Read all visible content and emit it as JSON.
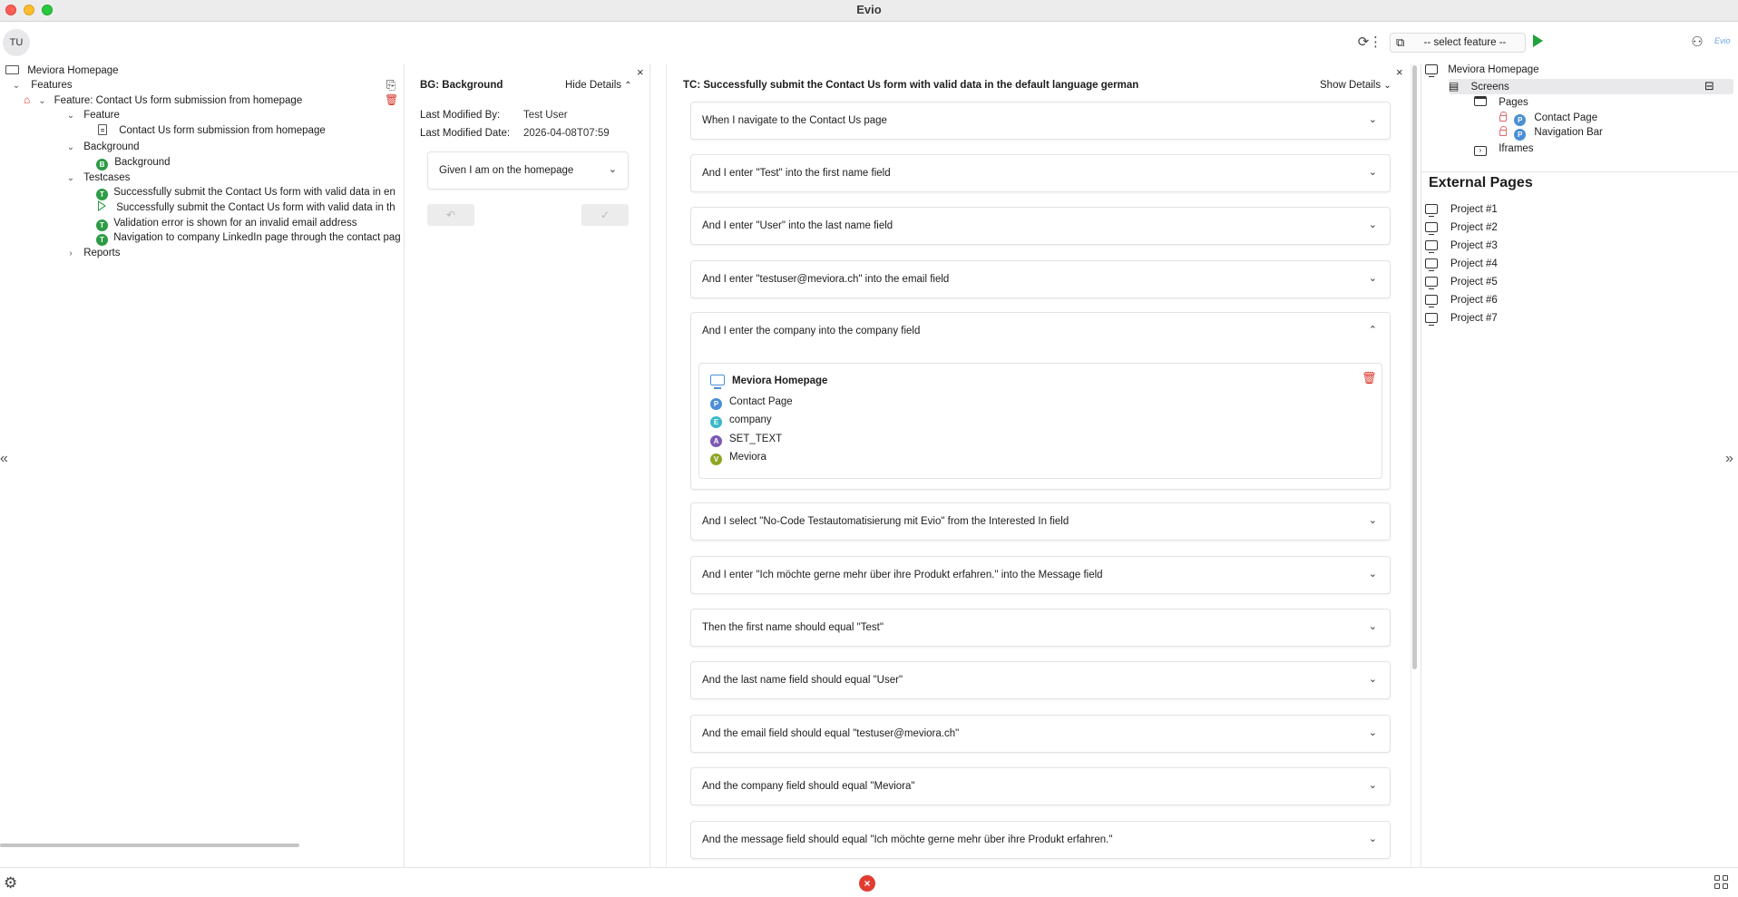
{
  "window": {
    "title": "Evio"
  },
  "toolbar": {
    "avatar_initials": "TU",
    "select_feature_label": "-- select feature --",
    "logo_text": "Evio"
  },
  "tree": {
    "root": "Meviora Homepage",
    "features_label": "Features",
    "feature_node": "Feature: Contact Us form submission from homepage",
    "feature_group": "Feature",
    "feature_file": "Contact Us form submission from homepage",
    "background_group": "Background",
    "background_item": "Background",
    "background_badge": "B",
    "testcases_group": "Testcases",
    "testcase_badge": "T",
    "testcases": [
      "Successfully submit the Contact Us form with valid data in en",
      "Successfully submit the Contact Us form with valid data in th",
      "Validation error is shown for an invalid email address",
      "Navigation to company LinkedIn page through the contact pag"
    ],
    "reports_label": "Reports"
  },
  "background_panel": {
    "title": "BG: Background",
    "toggle_label": "Hide Details",
    "modified_by_label": "Last Modified By:",
    "modified_by_value": "Test User",
    "modified_date_label": "Last Modified Date:",
    "modified_date_value": "2026-04-08T07:59",
    "given_step": "Given I am on the homepage"
  },
  "testcase_panel": {
    "title": "TC: Successfully submit the Contact Us form with valid data in the default language german",
    "toggle_label": "Show Details",
    "steps": [
      "When I navigate to the Contact Us page",
      "And I enter \"Test\" into the first name field",
      "And I enter \"User\" into the last name field",
      "And I enter \"testuser@meviora.ch\" into the email field",
      "And I enter the company into the company field",
      "And I select \"No-Code Testautomatisierung mit Evio\" from the Interested In field",
      "And I enter \"Ich möchte gerne mehr über ihre Produkt erfahren.\" into the Message field",
      "Then the first name should equal \"Test\"",
      "And the last name field should equal \"User\"",
      "And the email field should equal \"testuser@meviora.ch\"",
      "And the company field should equal \"Meviora\"",
      "And the message field should equal \"Ich möchte gerne mehr über ihre Produkt erfahren.\""
    ],
    "expanded_details": {
      "screen": "Meviora Homepage",
      "page": "Contact Page",
      "page_badge": "P",
      "element": "company",
      "element_badge": "E",
      "action": "SET_TEXT",
      "action_badge": "A",
      "value": "Meviora",
      "value_badge": "V"
    }
  },
  "right_panel": {
    "root": "Meviora Homepage",
    "screens_label": "Screens",
    "pages_label": "Pages",
    "page_badge": "P",
    "pages": [
      "Contact Page",
      "Navigation Bar"
    ],
    "iframes_label": "Iframes",
    "external_title": "External Pages",
    "projects": [
      "Project #1",
      "Project #2",
      "Project #3",
      "Project #4",
      "Project #5",
      "Project #6",
      "Project #7"
    ]
  },
  "statusbar": {
    "error_symbol": "×"
  },
  "colors": {
    "accent_green": "#2e9b46",
    "accent_blue": "#4a8fd6",
    "error_red": "#e23c31"
  }
}
